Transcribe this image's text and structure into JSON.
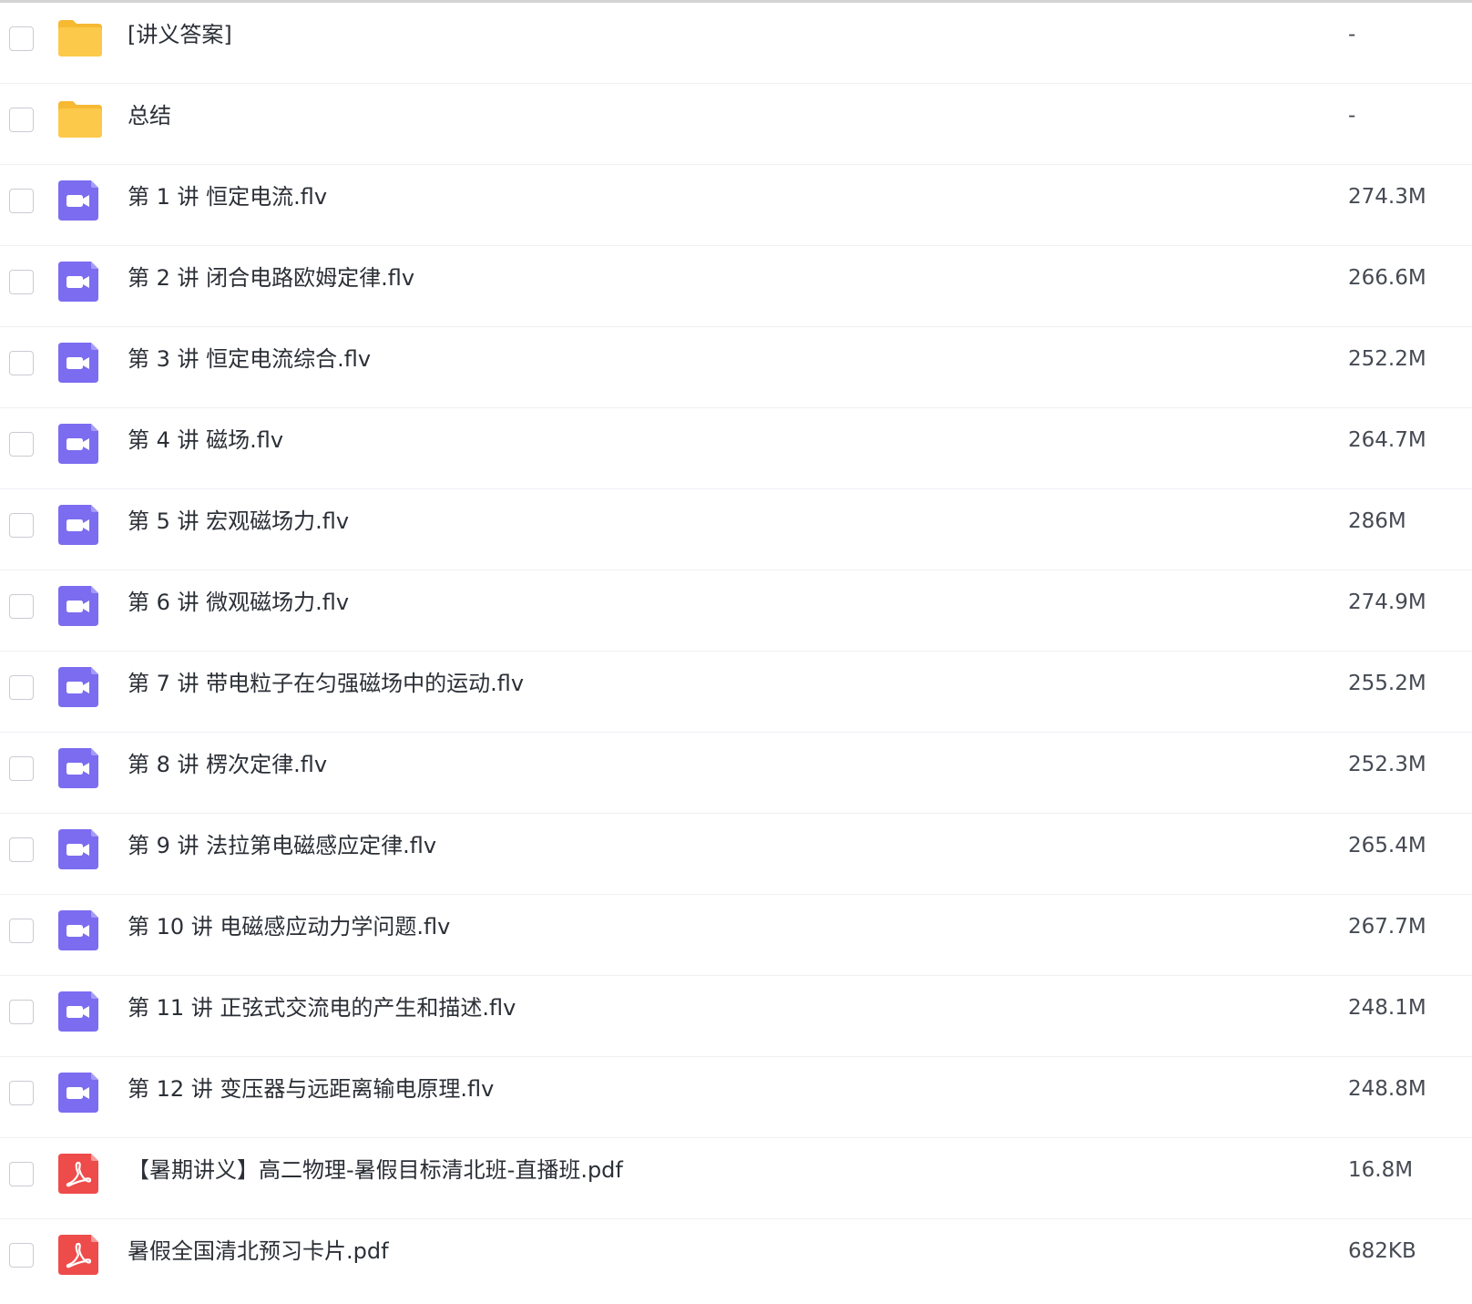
{
  "colors": {
    "folder": "#fcc94a",
    "folder_tab": "#f6b932",
    "video": "#7b6cf0",
    "pdf": "#ee4b4b",
    "text": "#2b2f36",
    "size_text": "#454a53",
    "divider": "#eef0f4"
  },
  "files": [
    {
      "name": "[讲义答案]",
      "size": "-",
      "type": "folder",
      "icon": "folder-icon"
    },
    {
      "name": "总结",
      "size": "-",
      "type": "folder",
      "icon": "folder-icon"
    },
    {
      "name": "第 1 讲 恒定电流.flv",
      "size": "274.3M",
      "type": "video",
      "icon": "video-camera-icon"
    },
    {
      "name": "第 2 讲 闭合电路欧姆定律.flv",
      "size": "266.6M",
      "type": "video",
      "icon": "video-camera-icon"
    },
    {
      "name": "第 3 讲 恒定电流综合.flv",
      "size": "252.2M",
      "type": "video",
      "icon": "video-camera-icon"
    },
    {
      "name": "第 4 讲 磁场.flv",
      "size": "264.7M",
      "type": "video",
      "icon": "video-camera-icon"
    },
    {
      "name": "第 5 讲 宏观磁场力.flv",
      "size": "286M",
      "type": "video",
      "icon": "video-camera-icon"
    },
    {
      "name": "第 6 讲 微观磁场力.flv",
      "size": "274.9M",
      "type": "video",
      "icon": "video-camera-icon"
    },
    {
      "name": "第 7 讲 带电粒子在匀强磁场中的运动.flv",
      "size": "255.2M",
      "type": "video",
      "icon": "video-camera-icon"
    },
    {
      "name": "第 8 讲 楞次定律.flv",
      "size": "252.3M",
      "type": "video",
      "icon": "video-camera-icon"
    },
    {
      "name": "第 9 讲 法拉第电磁感应定律.flv",
      "size": "265.4M",
      "type": "video",
      "icon": "video-camera-icon"
    },
    {
      "name": "第 10 讲 电磁感应动力学问题.flv",
      "size": "267.7M",
      "type": "video",
      "icon": "video-camera-icon"
    },
    {
      "name": "第 11 讲 正弦式交流电的产生和描述.flv",
      "size": "248.1M",
      "type": "video",
      "icon": "video-camera-icon"
    },
    {
      "name": "第 12 讲 变压器与远距离输电原理.flv",
      "size": "248.8M",
      "type": "video",
      "icon": "video-camera-icon"
    },
    {
      "name": "【暑期讲义】高二物理-暑假目标清北班-直播班.pdf",
      "size": "16.8M",
      "type": "pdf",
      "icon": "pdf-icon"
    },
    {
      "name": "暑假全国清北预习卡片.pdf",
      "size": "682KB",
      "type": "pdf",
      "icon": "pdf-icon"
    }
  ]
}
